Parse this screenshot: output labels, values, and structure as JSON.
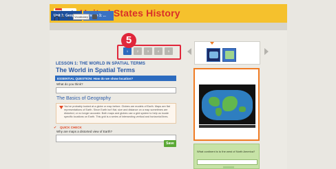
{
  "header": {
    "brand": "networks",
    "title": "United States History"
  },
  "nav": {
    "crumbs": [
      "Unit 1: Geog...",
      "Lesson 1: ..."
    ]
  },
  "toolbar": {
    "font_large": "A",
    "font_small": "A",
    "vocabulary": "Vocabulary"
  },
  "callout": {
    "number": "5"
  },
  "pager": {
    "pages": [
      "1",
      "2",
      "3",
      "4",
      "5"
    ],
    "active_index": 0
  },
  "lesson": {
    "label": "LESSON 1: THE WORLD IN SPATIAL TERMS",
    "title": "The World in Spatial Terms",
    "essential_question": "ESSENTIAL QUESTION: How do we show location?",
    "prompt": "What do you think?"
  },
  "basics": {
    "heading": "The Basics of Geography",
    "body": "You've probably looked at a globe or map before. Globes are models of Earth. Maps are flat representations of Earth. Since Earth isn't flat, size and distance on a map sometimes are distorted, or no longer accurate. Both maps and globes use a grid system to help us locate specific locations on Earth. This grid is a series of intersecting vertical and horizontal lines."
  },
  "quick_check": {
    "label": "QUICK CHECK",
    "question": "Why are maps a distorted view of Earth?",
    "save_label": "Save"
  },
  "right_panel": {
    "question": "What continent is to the west of North America?"
  }
}
